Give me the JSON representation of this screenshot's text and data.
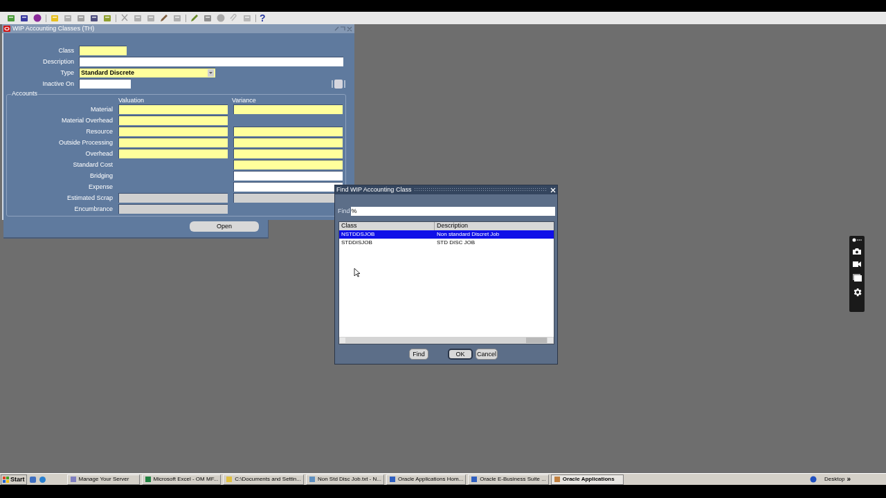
{
  "toolbar": {
    "help_glyph": "?"
  },
  "form_window": {
    "title": "WIP Accounting Classes (TH)",
    "fields": [
      {
        "label": "Class",
        "kind": "required"
      },
      {
        "label": "Description",
        "kind": "optional"
      },
      {
        "label": "Type",
        "kind": "required",
        "value": "Standard Discrete"
      },
      {
        "label": "Inactive On",
        "kind": "optional"
      }
    ],
    "accounts": {
      "title": "Accounts",
      "columns": [
        "Valuation",
        "Variance"
      ],
      "rows": [
        {
          "label": "Material",
          "valuation": {
            "kind": "required"
          },
          "variance": {
            "kind": "required"
          }
        },
        {
          "label": "Material Overhead",
          "valuation": {
            "kind": "required"
          }
        },
        {
          "label": "Resource",
          "valuation": {
            "kind": "required"
          },
          "variance": {
            "kind": "required"
          }
        },
        {
          "label": "Outside Processing",
          "valuation": {
            "kind": "required"
          },
          "variance": {
            "kind": "required"
          }
        },
        {
          "label": "Overhead",
          "valuation": {
            "kind": "required"
          },
          "variance": {
            "kind": "required"
          }
        },
        {
          "label": "Standard Cost",
          "variance": {
            "kind": "required"
          }
        },
        {
          "label": "Bridging",
          "variance": {
            "kind": "optional"
          }
        },
        {
          "label": "Expense",
          "variance": {
            "kind": "optional"
          }
        },
        {
          "label": "Estimated Scrap",
          "valuation": {
            "kind": "disabled"
          },
          "variance": {
            "kind": "disabled"
          }
        },
        {
          "label": "Encumbrance",
          "valuation": {
            "kind": "disabled"
          }
        }
      ]
    },
    "open_button": "Open"
  },
  "dialog": {
    "title": "Find WIP Accounting Class",
    "find_label": "Find",
    "find_value": "%",
    "columns": [
      "Class",
      "Description"
    ],
    "rows": [
      {
        "class": "NSTDDSJOB",
        "description": "Non standard Discret Job",
        "selected": true
      },
      {
        "class": "STDDISJOB",
        "description": "STD DISC JOB",
        "selected": false
      }
    ],
    "buttons": [
      {
        "label": "Find",
        "default": false
      },
      {
        "label": "OK",
        "default": true
      },
      {
        "label": "Cancel",
        "default": false
      }
    ]
  },
  "taskbar": {
    "start": "Start",
    "items": [
      {
        "label": "Manage Your Server",
        "selected": false
      },
      {
        "label": "Microsoft Excel - OM MF...",
        "selected": false
      },
      {
        "label": "C:\\Documents and Settin...",
        "selected": false
      },
      {
        "label": "Non Std Disc Job.txt - N...",
        "selected": false
      },
      {
        "label": "Oracle Applications Hom...",
        "selected": false
      },
      {
        "label": "Oracle E-Business Suite ...",
        "selected": false
      },
      {
        "label": "Oracle Applications",
        "selected": true
      }
    ],
    "desktop": "Desktop",
    "chevron": "»"
  }
}
